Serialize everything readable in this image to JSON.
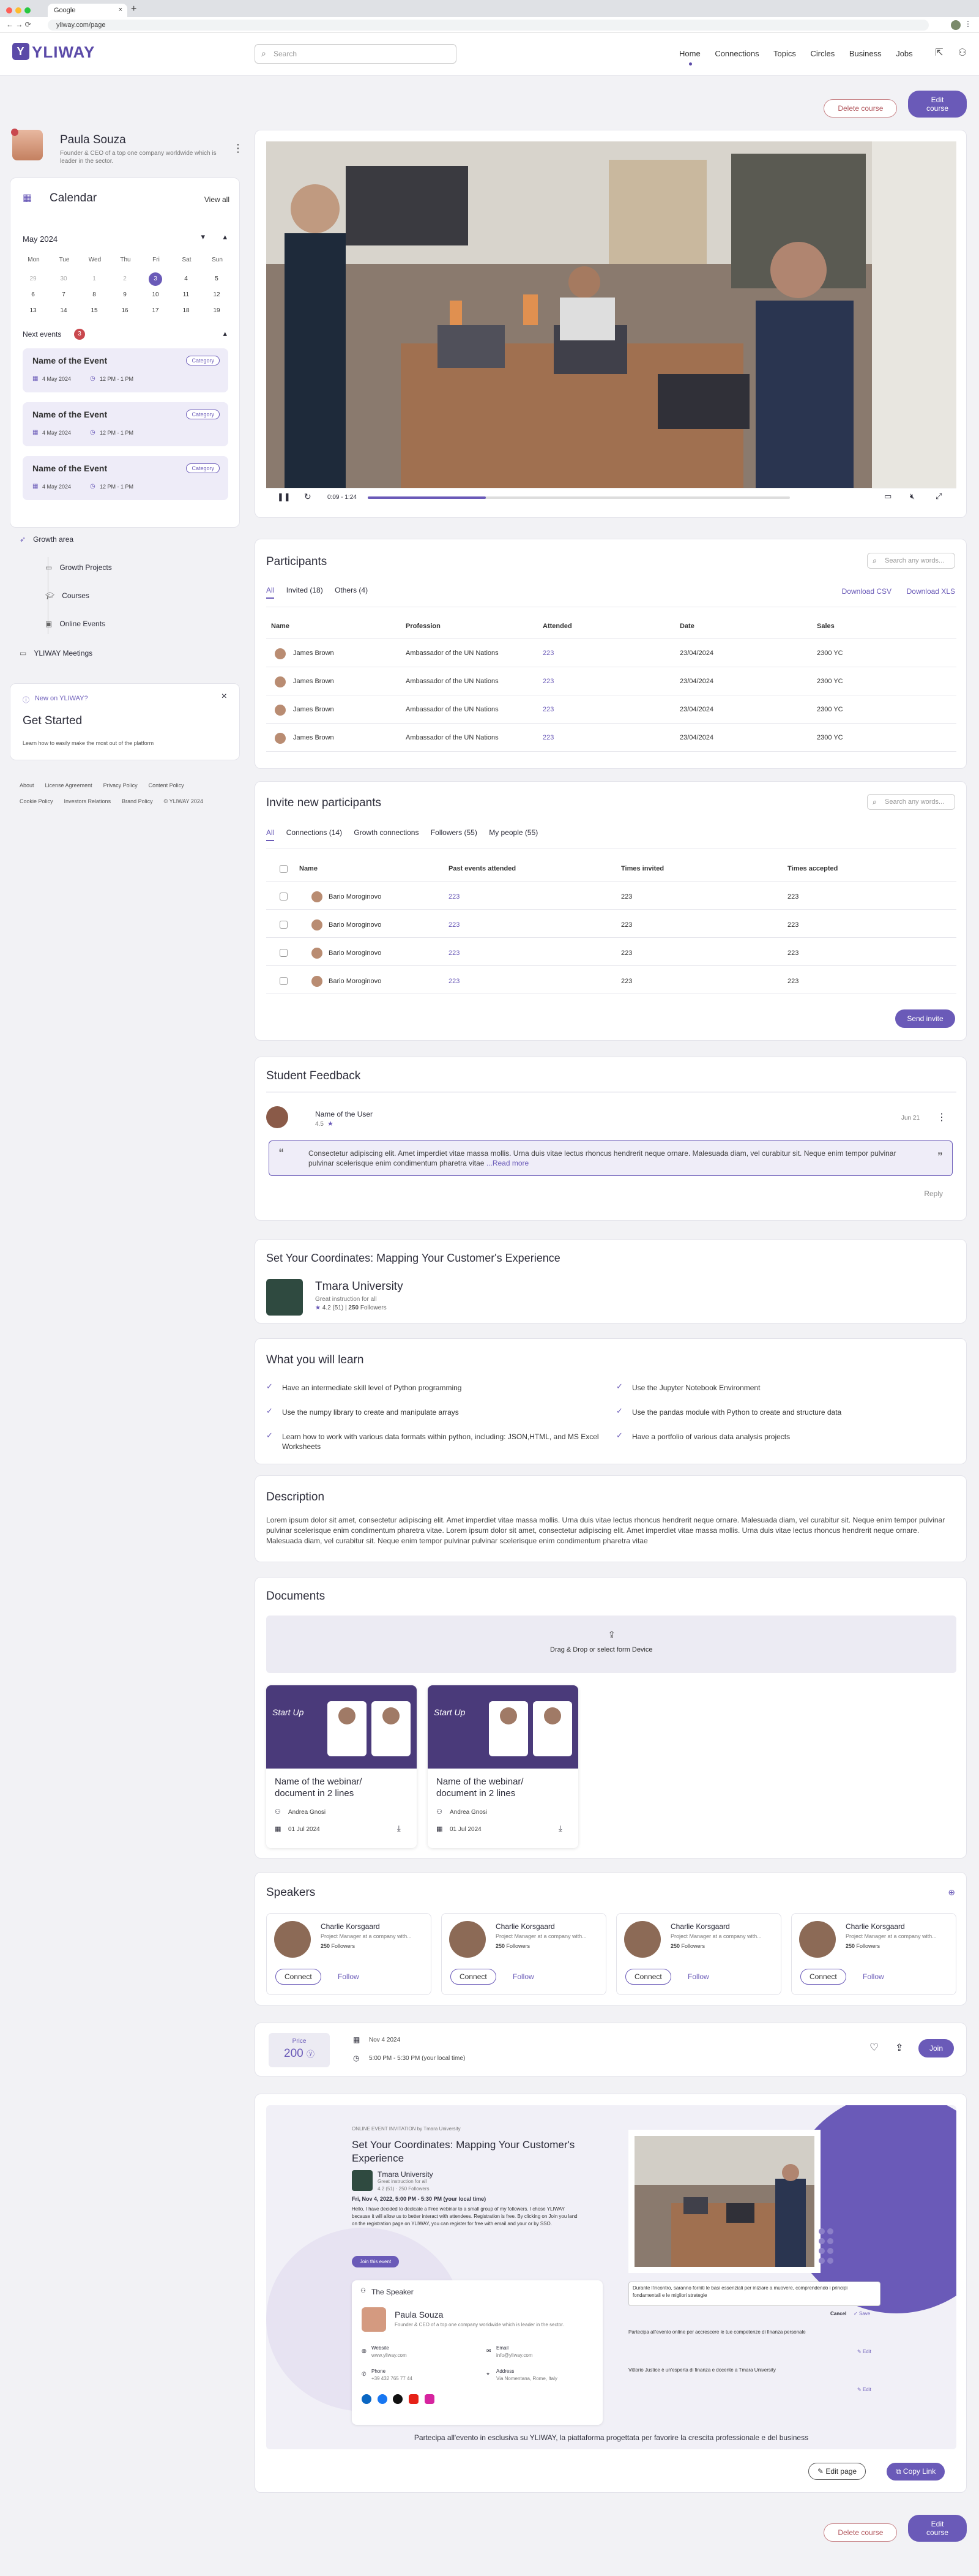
{
  "browser": {
    "tab_title": "Google",
    "url": "yliway.com/page"
  },
  "nav": {
    "logo": "YLIWAY",
    "search_placeholder": "Search",
    "items": [
      "Home",
      "Connections",
      "Topics",
      "Circles",
      "Business",
      "Jobs"
    ]
  },
  "actions": {
    "delete": "Delete course",
    "edit": "Edit course"
  },
  "profile": {
    "name": "Paula Souza",
    "bio": "Founder & CEO of a top one company worldwide which is leader in the sector."
  },
  "calendar": {
    "title": "Calendar",
    "view_all": "View all",
    "month": "May 2024",
    "weekdays": [
      "Mon",
      "Tue",
      "Wed",
      "Thu",
      "Fri",
      "Sat",
      "Sun"
    ],
    "weeks": [
      [
        "29",
        "30",
        "1",
        "2",
        "3",
        "4",
        "5"
      ],
      [
        "6",
        "7",
        "8",
        "9",
        "10",
        "11",
        "12"
      ],
      [
        "13",
        "14",
        "15",
        "16",
        "17",
        "18",
        "19"
      ]
    ],
    "next_events_label": "Next events",
    "next_events_count": "3",
    "events": [
      {
        "name": "Name of the Event",
        "category": "Category",
        "date": "4 May 2024",
        "time": "12 PM - 1 PM"
      },
      {
        "name": "Name of the Event",
        "category": "Category",
        "date": "4 May 2024",
        "time": "12 PM - 1 PM"
      },
      {
        "name": "Name of the Event",
        "category": "Category",
        "date": "4 May 2024",
        "time": "12 PM - 1 PM"
      }
    ]
  },
  "side_menu": {
    "growth_area": "Growth area",
    "items": [
      "Growth Projects",
      "Courses",
      "Online Events"
    ],
    "meetings": "YLIWAY Meetings"
  },
  "get_started": {
    "badge": "New on YLIWAY?",
    "title": "Get Started",
    "text": "Learn how to easily make the most out of the platform"
  },
  "footer_links": [
    "About",
    "License Agreement",
    "Privacy Policy",
    "Content Policy",
    "Cookie Policy",
    "Investors Relations",
    "Brand Policy",
    "© YLIWAY 2024"
  ],
  "video": {
    "time": "0:09 - 1:24",
    "progress": 0.28
  },
  "participants": {
    "title": "Participants",
    "search_placeholder": "Search any words...",
    "tabs": [
      "All",
      "Invited (18)",
      "Others (4)"
    ],
    "download_csv": "Download CSV",
    "download_xls": "Download XLS",
    "columns": [
      "Name",
      "Profession",
      "Attended",
      "Date",
      "Sales"
    ],
    "rows": [
      [
        "James Brown",
        "Ambassador of the UN Nations",
        "223",
        "23/04/2024",
        "2300 YC"
      ],
      [
        "James Brown",
        "Ambassador of the UN Nations",
        "223",
        "23/04/2024",
        "2300 YC"
      ],
      [
        "James Brown",
        "Ambassador of the UN Nations",
        "223",
        "23/04/2024",
        "2300 YC"
      ],
      [
        "James Brown",
        "Ambassador of the UN Nations",
        "223",
        "23/04/2024",
        "2300 YC"
      ]
    ]
  },
  "invite": {
    "title": "Invite new participants",
    "search_placeholder": "Search any words...",
    "tabs": [
      "All",
      "Connections (14)",
      "Growth connections",
      "Followers (55)",
      "My people (55)"
    ],
    "columns": [
      "Name",
      "Past events attended",
      "Times invited",
      "Times accepted"
    ],
    "rows": [
      [
        "Bario Moroginovo",
        "223",
        "223",
        "223"
      ],
      [
        "Bario Moroginovo",
        "223",
        "223",
        "223"
      ],
      [
        "Bario Moroginovo",
        "223",
        "223",
        "223"
      ],
      [
        "Bario Moroginovo",
        "223",
        "223",
        "223"
      ]
    ],
    "send": "Send invite"
  },
  "feedback": {
    "title": "Student Feedback",
    "user": "Name of the User",
    "rating": "4.5",
    "date": "Jun 21",
    "text": "Consectetur adipiscing elit. Amet imperdiet vitae massa mollis. Urna duis vitae lectus rhoncus hendrerit neque ornare. Malesuada diam, vel curabitur sit. Neque enim tempor pulvinar pulvinar scelerisque enim condimentum pharetra vitae",
    "read_more": "...Read more",
    "reply": "Reply"
  },
  "course": {
    "title": "Set Your Coordinates: Mapping Your Customer's Experience",
    "org": "Tmara University",
    "tagline": "Great instruction for all",
    "rating": "4.2 (51)",
    "followers": "250",
    "followers_label": "Followers"
  },
  "learn": {
    "title": "What you will learn",
    "items": [
      "Have an intermediate skill level of Python programming",
      "Use the Jupyter Notebook Environment",
      "Use the numpy library to create and manipulate arrays",
      "Use the pandas module with Python to create and structure data",
      "Learn how to work with various data formats within python, including: JSON,HTML, and MS Excel Worksheets",
      "Have a portfolio of various data analysis projects"
    ]
  },
  "description": {
    "title": "Description",
    "text": "Lorem ipsum dolor sit amet, consectetur adipiscing elit. Amet imperdiet vitae massa mollis. Urna duis vitae lectus rhoncus hendrerit neque ornare. Malesuada diam, vel curabitur sit. Neque enim tempor pulvinar pulvinar scelerisque enim condimentum pharetra vitae. Lorem ipsum dolor sit amet, consectetur adipiscing elit. Amet imperdiet vitae massa mollis. Urna duis vitae lectus rhoncus hendrerit neque ornare. Malesuada diam, vel curabitur sit. Neque enim tempor pulvinar pulvinar scelerisque enim condimentum pharetra vitae"
  },
  "documents": {
    "title": "Documents",
    "drop": "Drag & Drop or select form Device",
    "items": [
      {
        "thumb_label": "Start Up",
        "name": "Name of the webinar/ document in 2 lines",
        "author": "Andrea Gnosi",
        "date": "01 Jul 2024"
      },
      {
        "thumb_label": "Start Up",
        "name": "Name of the webinar/ document in 2 lines",
        "author": "Andrea Gnosi",
        "date": "01 Jul 2024"
      }
    ]
  },
  "speakers": {
    "title": "Speakers",
    "items": [
      {
        "name": "Charlie Korsgaard",
        "role": "Project Manager at a company with...",
        "followers": "250",
        "followers_label": "Followers",
        "connect": "Connect",
        "follow": "Follow"
      },
      {
        "name": "Charlie Korsgaard",
        "role": "Project Manager at a company with...",
        "followers": "250",
        "followers_label": "Followers",
        "connect": "Connect",
        "follow": "Follow"
      },
      {
        "name": "Charlie Korsgaard",
        "role": "Project Manager at a company with...",
        "followers": "250",
        "followers_label": "Followers",
        "connect": "Connect",
        "follow": "Follow"
      },
      {
        "name": "Charlie Korsgaard",
        "role": "Project Manager at a company with...",
        "followers": "250",
        "followers_label": "Followers",
        "connect": "Connect",
        "follow": "Follow"
      }
    ]
  },
  "join": {
    "price_label": "Price",
    "price": "200",
    "date": "Nov 4 2024",
    "time": "5:00 PM - 5:30 PM (your local time)",
    "join": "Join"
  },
  "invitation": {
    "header": "ONLINE EVENT INVITATION by Tmara University",
    "title": "Set Your Coordinates: Mapping Your Customer's Experience",
    "org": "Tmara University",
    "org_tagline": "Great instruction for all",
    "org_rating": "4.2 (51) · 250 Followers",
    "datetime": "Fri, Nov 4, 2022, 5:00 PM - 5:30 PM (your local time)",
    "body": "Hello, I have decided to dedicate a Free webinar to a small group of my followers. I chose YLIWAY because it will allow us to better interact with attendees. Registration is free. By clicking on Join you land on the registration page on YLIWAY, you can register for free with email and your or by SSO.",
    "join_btn": "Join this event",
    "speaker_label": "The Speaker",
    "speaker_name": "Paula Souza",
    "speaker_bio": "Founder & CEO of a top one company worldwide which is leader in the sector.",
    "website_label": "Website",
    "website": "www.yliway.com",
    "email_label": "Email",
    "email": "info@yliway.com",
    "phone_label": "Phone",
    "phone": "+39 432 765 77 44",
    "address_label": "Address",
    "address": "Via Nomentana, Rome, Italy",
    "note1": "Durante l'incontro, saranno forniti le basi essenziali per iniziare a muovere, comprendendo i principi fondamentali e le migliori strategie",
    "cancel": "Cancel",
    "save": "Save",
    "note2": "Partecipa all'evento online per accrescere le tue competenze di finanza personale",
    "note3": "Vittorio Justice è un'esperta di finanza e docente a Tmara University",
    "edit": "Edit",
    "tagline": "Partecipa all'evento in esclusiva su YLIWAY, la piattaforma progettata per favorire la crescita professionale e del business",
    "edit_page": "Edit page",
    "copy_link": "Copy Link"
  }
}
